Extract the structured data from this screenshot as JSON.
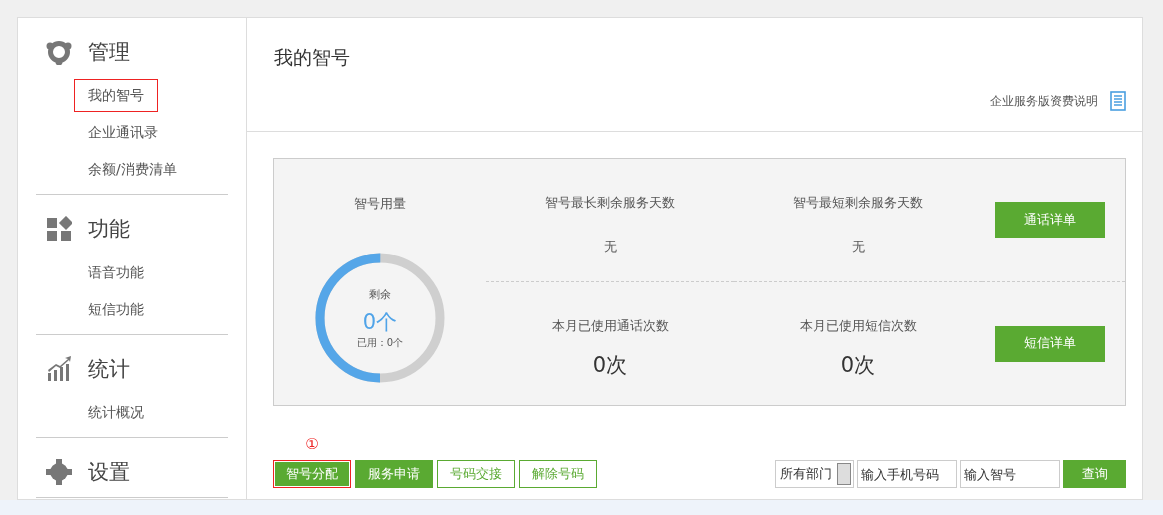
{
  "sidebar": {
    "groups": [
      {
        "kind": "manage",
        "title": "管理",
        "items": [
          {
            "label": "我的智号",
            "highlighted": true
          },
          {
            "label": "企业通讯录",
            "highlighted": false
          },
          {
            "label": "余额/消费清单",
            "highlighted": false
          }
        ]
      },
      {
        "kind": "functions",
        "title": "功能",
        "items": [
          {
            "label": "语音功能",
            "highlighted": false
          },
          {
            "label": "短信功能",
            "highlighted": false
          }
        ]
      },
      {
        "kind": "stats",
        "title": "统计",
        "items": [
          {
            "label": "统计概况",
            "highlighted": false
          }
        ]
      },
      {
        "kind": "settings",
        "title": "设置"
      }
    ]
  },
  "page": {
    "title": "我的智号",
    "pricing_link": "企业服务版资费说明"
  },
  "summary": {
    "usage": {
      "title": "智号用量",
      "remaining_label": "剩余",
      "remaining": "0个",
      "used": "已用：0个",
      "level": 0.5
    },
    "stats": [
      {
        "label": "智号最长剩余服务天数",
        "value": "无",
        "kind": "text"
      },
      {
        "label": "智号最短剩余服务天数",
        "value": "无",
        "kind": "text"
      },
      {
        "label": "本月已使用通话次数",
        "value": "0次",
        "kind": "count"
      },
      {
        "label": "本月已使用短信次数",
        "value": "0次",
        "kind": "count"
      }
    ],
    "buttons": [
      "通话详单",
      "短信详单"
    ]
  },
  "toolbar": {
    "buttons": [
      {
        "label": "智号分配",
        "kind": "filled",
        "highlighted": true,
        "annotation": "①"
      },
      {
        "label": "服务申请",
        "kind": "filled",
        "highlighted": false
      },
      {
        "label": "号码交接",
        "kind": "outline",
        "highlighted": false
      },
      {
        "label": "解除号码",
        "kind": "outline",
        "highlighted": false
      }
    ],
    "department": "所有部门",
    "phone_placeholder": "输入手机号码",
    "number_placeholder": "输入智号",
    "search_button": "查询"
  }
}
